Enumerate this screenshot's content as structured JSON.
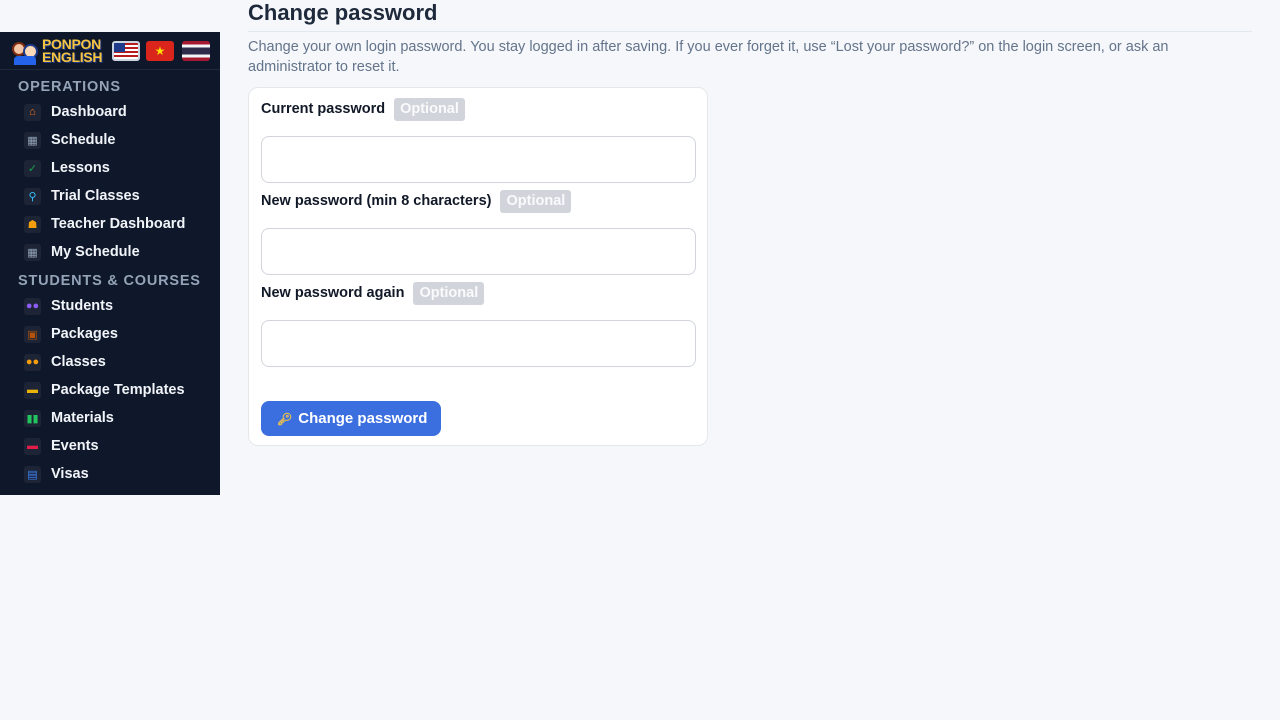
{
  "brand": {
    "line1": "PONPON",
    "line2": "ENGLISH"
  },
  "languages": [
    {
      "name": "us-flag-icon"
    },
    {
      "name": "vietnam-flag-icon"
    },
    {
      "name": "thailand-flag-icon"
    }
  ],
  "sidebar": {
    "sections": [
      {
        "title": "OPERATIONS",
        "items": [
          {
            "label": "Dashboard",
            "icon": "house-icon",
            "glyph": "⌂",
            "color": "#f97316"
          },
          {
            "label": "Schedule",
            "icon": "calendar-icon",
            "glyph": "▦",
            "color": "#94a3b8"
          },
          {
            "label": "Lessons",
            "icon": "check-icon",
            "glyph": "✓",
            "color": "#16a34a"
          },
          {
            "label": "Trial Classes",
            "icon": "magnifier-icon",
            "glyph": "⚲",
            "color": "#38bdf8"
          },
          {
            "label": "Teacher Dashboard",
            "icon": "teacher-icon",
            "glyph": "☗",
            "color": "#f59e0b"
          },
          {
            "label": "My Schedule",
            "icon": "calendar-icon",
            "glyph": "▦",
            "color": "#94a3b8"
          }
        ]
      },
      {
        "title": "STUDENTS & COURSES",
        "items": [
          {
            "label": "Students",
            "icon": "people-icon",
            "glyph": "●●",
            "color": "#8b5cf6"
          },
          {
            "label": "Packages",
            "icon": "package-icon",
            "glyph": "▣",
            "color": "#b45309"
          },
          {
            "label": "Classes",
            "icon": "group-icon",
            "glyph": "●●",
            "color": "#f59e0b"
          },
          {
            "label": "Package Templates",
            "icon": "folder-icon",
            "glyph": "▬",
            "color": "#eab308"
          },
          {
            "label": "Materials",
            "icon": "books-icon",
            "glyph": "▮▮",
            "color": "#22c55e"
          },
          {
            "label": "Events",
            "icon": "ticket-icon",
            "glyph": "▬",
            "color": "#e11d48"
          },
          {
            "label": "Visas",
            "icon": "passport-icon",
            "glyph": "▤",
            "color": "#3b82f6"
          }
        ]
      }
    ]
  },
  "page": {
    "title": "Change password",
    "description": "Change your own login password. You stay logged in after saving. If you ever forget it, use “Lost your password?” on the login screen, or ask an administrator to reset it."
  },
  "form": {
    "fields": [
      {
        "label": "Current password",
        "badge": "Optional",
        "value": ""
      },
      {
        "label": "New password (min 8 characters)",
        "badge": "Optional",
        "value": ""
      },
      {
        "label": "New password again",
        "badge": "Optional",
        "value": ""
      }
    ],
    "submit_label": "Change password",
    "submit_icon": "key-icon"
  }
}
